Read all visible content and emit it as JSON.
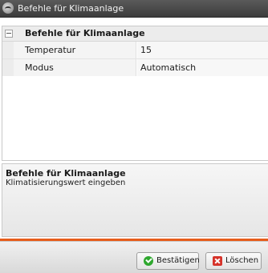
{
  "window": {
    "title": "Befehle für Klimaanlage"
  },
  "property_grid": {
    "category": "Befehle für Klimaanlage",
    "rows": [
      {
        "name": "Temperatur",
        "value": "15"
      },
      {
        "name": "Modus",
        "value": "Automatisch"
      }
    ]
  },
  "description": {
    "title": "Befehle für Klimaanlage",
    "text": "Klimatisierungswert eingeben"
  },
  "footer": {
    "confirm_label": "Bestätigen",
    "delete_label": "Löschen"
  },
  "colors": {
    "accent_line": "#e65c1a",
    "confirm_icon": "#2fa82f",
    "delete_icon": "#d6332a"
  },
  "icons": {
    "app": "app-logo-icon",
    "collapse": "collapse-minus-icon",
    "confirm": "check-circle-icon",
    "delete": "delete-x-icon"
  }
}
